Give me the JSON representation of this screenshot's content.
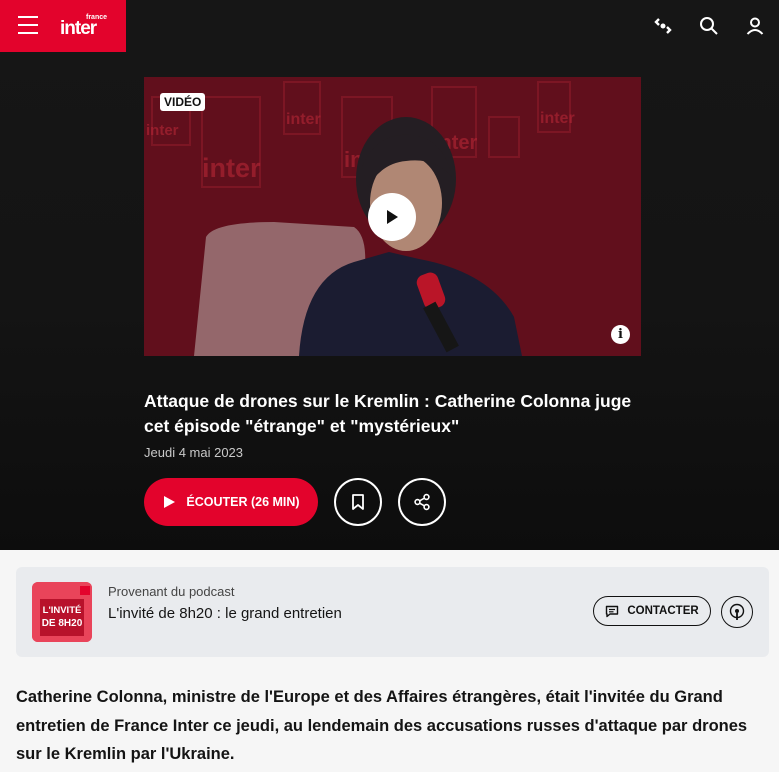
{
  "header": {
    "logo_small": "france",
    "logo_main": "inter",
    "icons": [
      "menu-icon",
      "radio-live-icon",
      "search-icon",
      "user-icon"
    ]
  },
  "video": {
    "badge": "VIDÉO",
    "background_logo": "inter",
    "icons": [
      "play-icon",
      "info-icon"
    ]
  },
  "episode": {
    "title": "Attaque de drones sur le Kremlin : Catherine Colonna juge cet épisode \"étrange\" et \"mystérieux\"",
    "date": "Jeudi 4 mai 2023",
    "listen_label": "ÉCOUTER (26 MIN)",
    "icons": [
      "bookmark-icon",
      "share-icon"
    ]
  },
  "podcast": {
    "kicker": "Provenant du podcast",
    "name": "L'invité de 8h20 : le grand entretien",
    "cover_text": [
      "L'INVITÉ",
      "DE 8H20"
    ],
    "contact_label": "CONTACTER",
    "icons": [
      "message-icon",
      "podcast-icon"
    ]
  },
  "summary": "Catherine Colonna, ministre de l'Europe et des Affaires étrangères, était l'invitée du Grand entretien de France Inter ce jeudi, au lendemain des accusations russes d'attaque par drones sur le Kremlin par l'Ukraine.",
  "colors": {
    "brand_red": "#e3032c",
    "hero_bg": "#141414",
    "card_bg": "#e9ebee",
    "cover_pink": "#e9445a"
  }
}
